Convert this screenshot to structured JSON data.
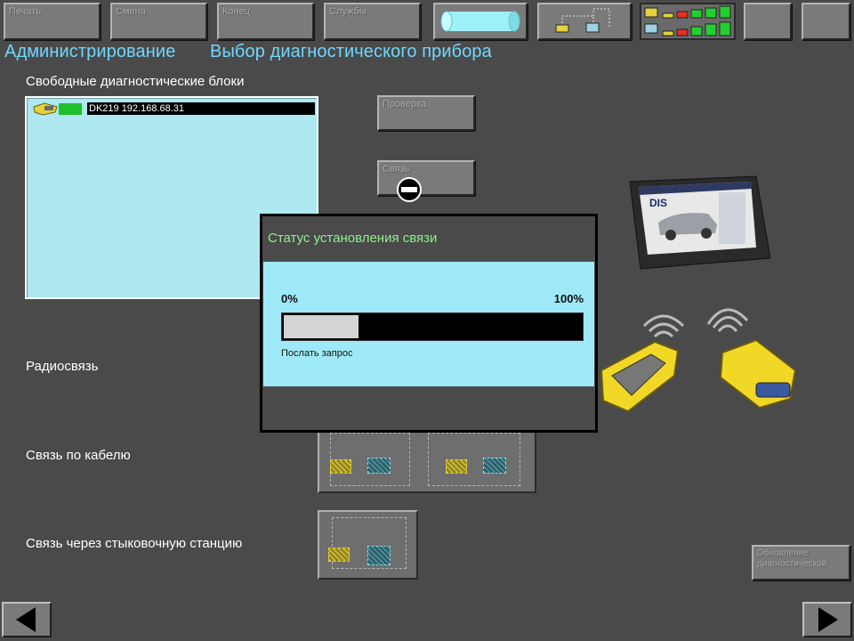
{
  "toolbar": {
    "print_label": "Печать",
    "change_label": "Смена",
    "end_label": "Конец",
    "services_label": "Службы"
  },
  "header": {
    "section": "Администрирование",
    "page": "Выбор диагностического прибора"
  },
  "free_units": {
    "title": "Свободные диагностические блоки",
    "items": [
      {
        "label": "DK219 192.168.68.31",
        "selected": true
      }
    ]
  },
  "side_buttons": {
    "check_label": "Проверка",
    "connect_label": "Связь"
  },
  "connection_types": {
    "radio": "Радиосвязь",
    "cable": "Связь по кабелю",
    "dock": "Связь через стыковочную станцию"
  },
  "dialog": {
    "title": "Статус установления связи",
    "min_label": "0%",
    "max_label": "100%",
    "progress": 0.25,
    "status": "Послать запрос"
  },
  "update_button": {
    "line1": "Обновление",
    "line2": "диагностической"
  },
  "illustration": {
    "screen_label": "DIS"
  },
  "colors": {
    "accent": "#6fd7ff",
    "dialog_title": "#8ff090",
    "list_bg": "#aee8f0",
    "dialog_body": "#9ee9f8",
    "background": "#4a4a4a"
  }
}
